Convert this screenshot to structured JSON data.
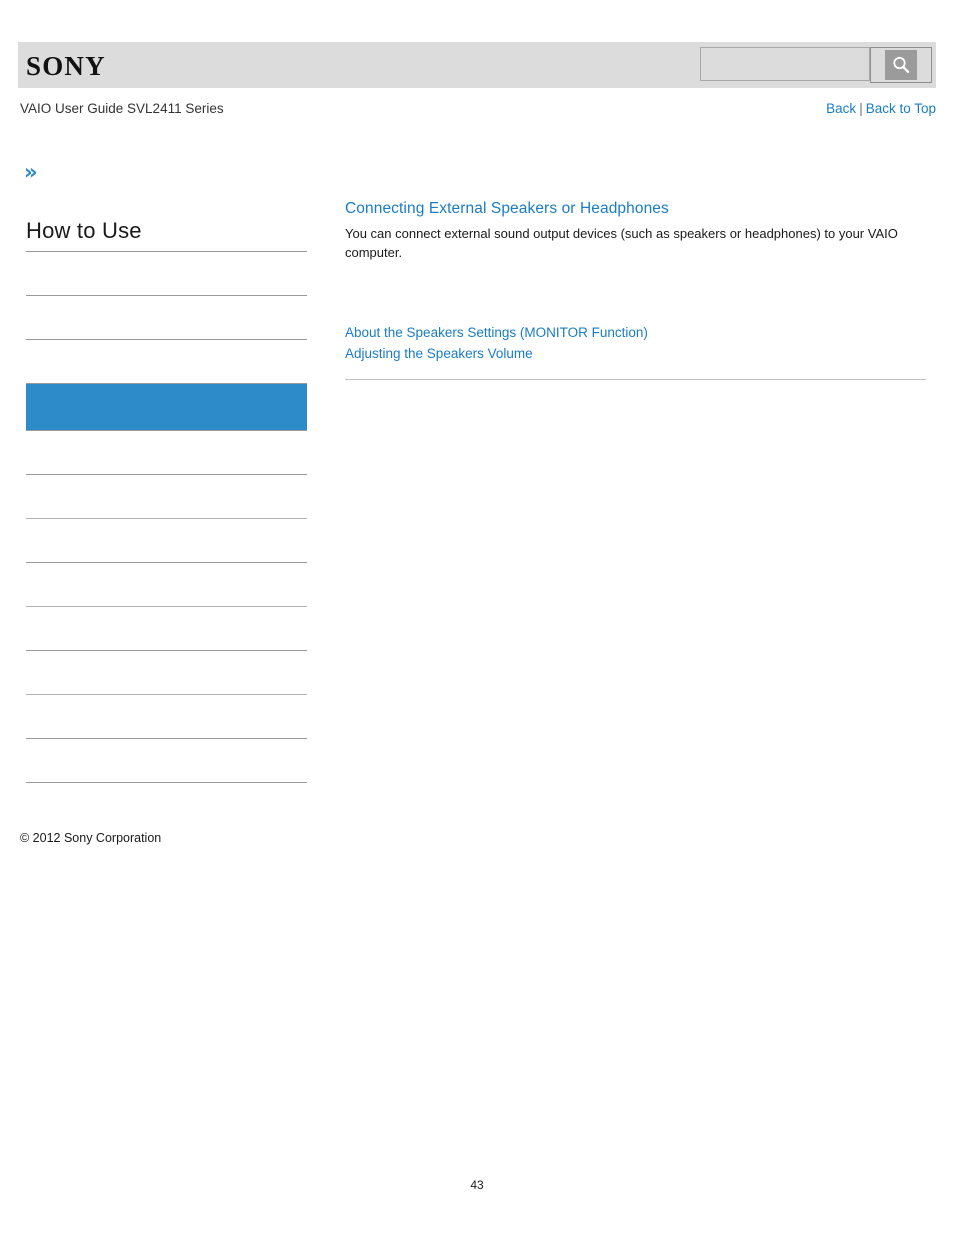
{
  "header": {
    "logo_text": "SONY",
    "search": {
      "value": "",
      "placeholder": "",
      "button_icon": "search-icon"
    }
  },
  "subheader": {
    "guide_title": "VAIO User Guide SVL2411 Series",
    "back_label": "Back",
    "separator": "|",
    "back_to_top_label": "Back to Top"
  },
  "sidebar": {
    "expand_icon": "chevron-double-right-icon",
    "title": "How to Use",
    "items": [
      {
        "label": "",
        "selected": false
      },
      {
        "label": "",
        "selected": false
      },
      {
        "label": "",
        "selected": false
      },
      {
        "label": "",
        "selected": true
      },
      {
        "label": "",
        "selected": false
      },
      {
        "label": "",
        "selected": false
      },
      {
        "label": "",
        "selected": false
      },
      {
        "label": "",
        "selected": false
      },
      {
        "label": "",
        "selected": false
      },
      {
        "label": "",
        "selected": false
      },
      {
        "label": "",
        "selected": false
      },
      {
        "label": "",
        "selected": false
      }
    ],
    "copyright": "© 2012 Sony Corporation"
  },
  "main": {
    "title": "Connecting External Speakers or Headphones",
    "paragraph": "You can connect external sound output devices (such as speakers or headphones) to your VAIO computer.",
    "related_links": [
      "About the Speakers Settings (MONITOR Function)",
      "Adjusting the Speakers Volume"
    ]
  },
  "footer": {
    "page_number": "43"
  },
  "colors": {
    "link_blue": "#1a7cc4",
    "accent_blue": "#2e8bca",
    "header_gray": "#dcdcdc",
    "rule_gray": "#9a9a9a"
  }
}
